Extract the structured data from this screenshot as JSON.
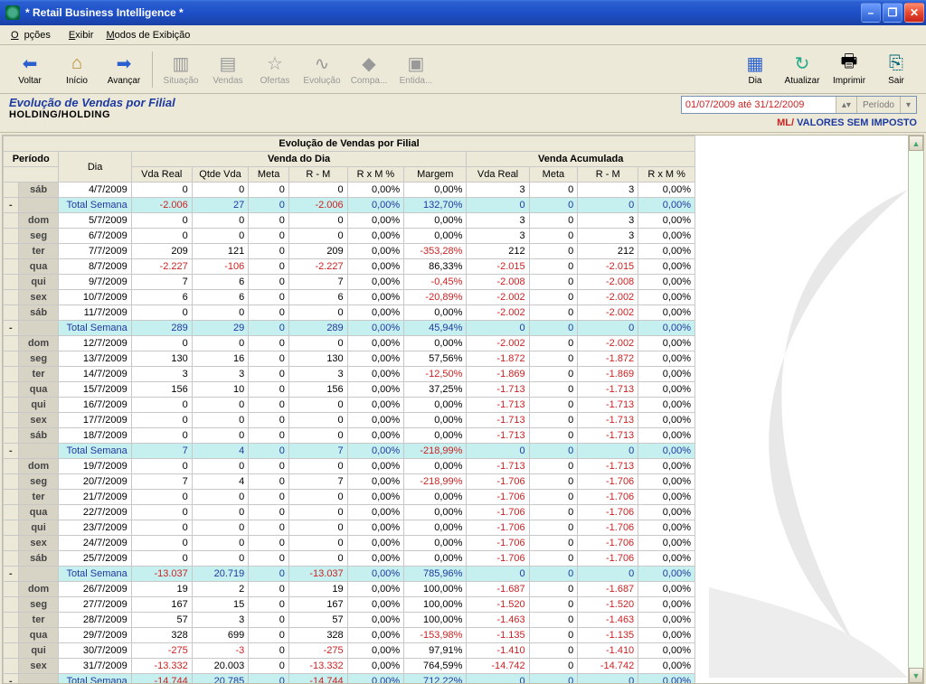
{
  "window": {
    "title": "* Retail Business Intelligence *"
  },
  "menu": {
    "opcoes": "Opções",
    "exibir": "Exibir",
    "modos": "Modos de Exibição"
  },
  "toolbar": {
    "voltar": "Voltar",
    "inicio": "Início",
    "avancar": "Avançar",
    "situacao": "Situação",
    "vendas": "Vendas",
    "ofertas": "Ofertas",
    "evolucao": "Evolução",
    "compa": "Compa...",
    "entida": "Entida...",
    "dia": "Dia",
    "atualizar": "Atualizar",
    "imprimir": "Imprimir",
    "sair": "Sair"
  },
  "header": {
    "title": "Evolução de Vendas por Filial",
    "path": "HOLDING/HOLDING",
    "date_range": "01/07/2009 até 31/12/2009",
    "period_label": "Período",
    "stamp_ml": "ML/",
    "stamp_blue": "VALORES SEM IMPOSTO"
  },
  "grid": {
    "title": "Evolução de Vendas por Filial",
    "grp_periodo": "Período",
    "grp_venda_dia": "Venda do Dia",
    "grp_venda_acum": "Venda Acumulada",
    "col_dia": "Dia",
    "col_vdareal": "Vda Real",
    "col_qtde": "Qtde Vda",
    "col_meta": "Meta",
    "col_rm": "R - M",
    "col_rxm": "R x M %",
    "col_margem": "Margem"
  },
  "rows": [
    {
      "exp": "",
      "dow": "sáb",
      "dia": "4/7/2009",
      "vr": "0",
      "qv": "0",
      "me": "0",
      "rm": "0",
      "rx": "0,00%",
      "mg": "0,00%",
      "avr": "3",
      "ame": "0",
      "arm": "3",
      "arx": "0,00%",
      "total": false,
      "neg": {}
    },
    {
      "exp": "-",
      "dow": "",
      "dia": "Total Semana",
      "vr": "-2.006",
      "qv": "27",
      "me": "0",
      "rm": "-2.006",
      "rx": "0,00%",
      "mg": "132,70%",
      "avr": "0",
      "ame": "0",
      "arm": "0",
      "arx": "0,00%",
      "total": true,
      "neg": {
        "vr": 1,
        "rm": 1
      }
    },
    {
      "exp": "",
      "dow": "dom",
      "dia": "5/7/2009",
      "vr": "0",
      "qv": "0",
      "me": "0",
      "rm": "0",
      "rx": "0,00%",
      "mg": "0,00%",
      "avr": "3",
      "ame": "0",
      "arm": "3",
      "arx": "0,00%",
      "total": false,
      "neg": {}
    },
    {
      "exp": "",
      "dow": "seg",
      "dia": "6/7/2009",
      "vr": "0",
      "qv": "0",
      "me": "0",
      "rm": "0",
      "rx": "0,00%",
      "mg": "0,00%",
      "avr": "3",
      "ame": "0",
      "arm": "3",
      "arx": "0,00%",
      "total": false,
      "neg": {}
    },
    {
      "exp": "",
      "dow": "ter",
      "dia": "7/7/2009",
      "vr": "209",
      "qv": "121",
      "me": "0",
      "rm": "209",
      "rx": "0,00%",
      "mg": "-353,28%",
      "avr": "212",
      "ame": "0",
      "arm": "212",
      "arx": "0,00%",
      "total": false,
      "neg": {
        "mg": 1
      }
    },
    {
      "exp": "",
      "dow": "qua",
      "dia": "8/7/2009",
      "vr": "-2.227",
      "qv": "-106",
      "me": "0",
      "rm": "-2.227",
      "rx": "0,00%",
      "mg": "86,33%",
      "avr": "-2.015",
      "ame": "0",
      "arm": "-2.015",
      "arx": "0,00%",
      "total": false,
      "neg": {
        "vr": 1,
        "qv": 1,
        "rm": 1,
        "avr": 1,
        "arm": 1
      }
    },
    {
      "exp": "",
      "dow": "qui",
      "dia": "9/7/2009",
      "vr": "7",
      "qv": "6",
      "me": "0",
      "rm": "7",
      "rx": "0,00%",
      "mg": "-0,45%",
      "avr": "-2.008",
      "ame": "0",
      "arm": "-2.008",
      "arx": "0,00%",
      "total": false,
      "neg": {
        "mg": 1,
        "avr": 1,
        "arm": 1
      }
    },
    {
      "exp": "",
      "dow": "sex",
      "dia": "10/7/2009",
      "vr": "6",
      "qv": "6",
      "me": "0",
      "rm": "6",
      "rx": "0,00%",
      "mg": "-20,89%",
      "avr": "-2.002",
      "ame": "0",
      "arm": "-2.002",
      "arx": "0,00%",
      "total": false,
      "neg": {
        "mg": 1,
        "avr": 1,
        "arm": 1
      }
    },
    {
      "exp": "",
      "dow": "sáb",
      "dia": "11/7/2009",
      "vr": "0",
      "qv": "0",
      "me": "0",
      "rm": "0",
      "rx": "0,00%",
      "mg": "0,00%",
      "avr": "-2.002",
      "ame": "0",
      "arm": "-2.002",
      "arx": "0,00%",
      "total": false,
      "neg": {
        "avr": 1,
        "arm": 1
      }
    },
    {
      "exp": "-",
      "dow": "",
      "dia": "Total Semana",
      "vr": "289",
      "qv": "29",
      "me": "0",
      "rm": "289",
      "rx": "0,00%",
      "mg": "45,94%",
      "avr": "0",
      "ame": "0",
      "arm": "0",
      "arx": "0,00%",
      "total": true,
      "neg": {}
    },
    {
      "exp": "",
      "dow": "dom",
      "dia": "12/7/2009",
      "vr": "0",
      "qv": "0",
      "me": "0",
      "rm": "0",
      "rx": "0,00%",
      "mg": "0,00%",
      "avr": "-2.002",
      "ame": "0",
      "arm": "-2.002",
      "arx": "0,00%",
      "total": false,
      "neg": {
        "avr": 1,
        "arm": 1
      }
    },
    {
      "exp": "",
      "dow": "seg",
      "dia": "13/7/2009",
      "vr": "130",
      "qv": "16",
      "me": "0",
      "rm": "130",
      "rx": "0,00%",
      "mg": "57,56%",
      "avr": "-1.872",
      "ame": "0",
      "arm": "-1.872",
      "arx": "0,00%",
      "total": false,
      "neg": {
        "avr": 1,
        "arm": 1
      }
    },
    {
      "exp": "",
      "dow": "ter",
      "dia": "14/7/2009",
      "vr": "3",
      "qv": "3",
      "me": "0",
      "rm": "3",
      "rx": "0,00%",
      "mg": "-12,50%",
      "avr": "-1.869",
      "ame": "0",
      "arm": "-1.869",
      "arx": "0,00%",
      "total": false,
      "neg": {
        "mg": 1,
        "avr": 1,
        "arm": 1
      }
    },
    {
      "exp": "",
      "dow": "qua",
      "dia": "15/7/2009",
      "vr": "156",
      "qv": "10",
      "me": "0",
      "rm": "156",
      "rx": "0,00%",
      "mg": "37,25%",
      "avr": "-1.713",
      "ame": "0",
      "arm": "-1.713",
      "arx": "0,00%",
      "total": false,
      "neg": {
        "avr": 1,
        "arm": 1
      }
    },
    {
      "exp": "",
      "dow": "qui",
      "dia": "16/7/2009",
      "vr": "0",
      "qv": "0",
      "me": "0",
      "rm": "0",
      "rx": "0,00%",
      "mg": "0,00%",
      "avr": "-1.713",
      "ame": "0",
      "arm": "-1.713",
      "arx": "0,00%",
      "total": false,
      "neg": {
        "avr": 1,
        "arm": 1
      }
    },
    {
      "exp": "",
      "dow": "sex",
      "dia": "17/7/2009",
      "vr": "0",
      "qv": "0",
      "me": "0",
      "rm": "0",
      "rx": "0,00%",
      "mg": "0,00%",
      "avr": "-1.713",
      "ame": "0",
      "arm": "-1.713",
      "arx": "0,00%",
      "total": false,
      "neg": {
        "avr": 1,
        "arm": 1
      }
    },
    {
      "exp": "",
      "dow": "sáb",
      "dia": "18/7/2009",
      "vr": "0",
      "qv": "0",
      "me": "0",
      "rm": "0",
      "rx": "0,00%",
      "mg": "0,00%",
      "avr": "-1.713",
      "ame": "0",
      "arm": "-1.713",
      "arx": "0,00%",
      "total": false,
      "neg": {
        "avr": 1,
        "arm": 1
      }
    },
    {
      "exp": "-",
      "dow": "",
      "dia": "Total Semana",
      "vr": "7",
      "qv": "4",
      "me": "0",
      "rm": "7",
      "rx": "0,00%",
      "mg": "-218,99%",
      "avr": "0",
      "ame": "0",
      "arm": "0",
      "arx": "0,00%",
      "total": true,
      "neg": {
        "mg": 1
      }
    },
    {
      "exp": "",
      "dow": "dom",
      "dia": "19/7/2009",
      "vr": "0",
      "qv": "0",
      "me": "0",
      "rm": "0",
      "rx": "0,00%",
      "mg": "0,00%",
      "avr": "-1.713",
      "ame": "0",
      "arm": "-1.713",
      "arx": "0,00%",
      "total": false,
      "neg": {
        "avr": 1,
        "arm": 1
      }
    },
    {
      "exp": "",
      "dow": "seg",
      "dia": "20/7/2009",
      "vr": "7",
      "qv": "4",
      "me": "0",
      "rm": "7",
      "rx": "0,00%",
      "mg": "-218,99%",
      "avr": "-1.706",
      "ame": "0",
      "arm": "-1.706",
      "arx": "0,00%",
      "total": false,
      "neg": {
        "mg": 1,
        "avr": 1,
        "arm": 1
      }
    },
    {
      "exp": "",
      "dow": "ter",
      "dia": "21/7/2009",
      "vr": "0",
      "qv": "0",
      "me": "0",
      "rm": "0",
      "rx": "0,00%",
      "mg": "0,00%",
      "avr": "-1.706",
      "ame": "0",
      "arm": "-1.706",
      "arx": "0,00%",
      "total": false,
      "neg": {
        "avr": 1,
        "arm": 1
      }
    },
    {
      "exp": "",
      "dow": "qua",
      "dia": "22/7/2009",
      "vr": "0",
      "qv": "0",
      "me": "0",
      "rm": "0",
      "rx": "0,00%",
      "mg": "0,00%",
      "avr": "-1.706",
      "ame": "0",
      "arm": "-1.706",
      "arx": "0,00%",
      "total": false,
      "neg": {
        "avr": 1,
        "arm": 1
      }
    },
    {
      "exp": "",
      "dow": "qui",
      "dia": "23/7/2009",
      "vr": "0",
      "qv": "0",
      "me": "0",
      "rm": "0",
      "rx": "0,00%",
      "mg": "0,00%",
      "avr": "-1.706",
      "ame": "0",
      "arm": "-1.706",
      "arx": "0,00%",
      "total": false,
      "neg": {
        "avr": 1,
        "arm": 1
      }
    },
    {
      "exp": "",
      "dow": "sex",
      "dia": "24/7/2009",
      "vr": "0",
      "qv": "0",
      "me": "0",
      "rm": "0",
      "rx": "0,00%",
      "mg": "0,00%",
      "avr": "-1.706",
      "ame": "0",
      "arm": "-1.706",
      "arx": "0,00%",
      "total": false,
      "neg": {
        "avr": 1,
        "arm": 1
      }
    },
    {
      "exp": "",
      "dow": "sáb",
      "dia": "25/7/2009",
      "vr": "0",
      "qv": "0",
      "me": "0",
      "rm": "0",
      "rx": "0,00%",
      "mg": "0,00%",
      "avr": "-1.706",
      "ame": "0",
      "arm": "-1.706",
      "arx": "0,00%",
      "total": false,
      "neg": {
        "avr": 1,
        "arm": 1
      }
    },
    {
      "exp": "-",
      "dow": "",
      "dia": "Total Semana",
      "vr": "-13.037",
      "qv": "20.719",
      "me": "0",
      "rm": "-13.037",
      "rx": "0,00%",
      "mg": "785,96%",
      "avr": "0",
      "ame": "0",
      "arm": "0",
      "arx": "0,00%",
      "total": true,
      "neg": {
        "vr": 1,
        "rm": 1
      }
    },
    {
      "exp": "",
      "dow": "dom",
      "dia": "26/7/2009",
      "vr": "19",
      "qv": "2",
      "me": "0",
      "rm": "19",
      "rx": "0,00%",
      "mg": "100,00%",
      "avr": "-1.687",
      "ame": "0",
      "arm": "-1.687",
      "arx": "0,00%",
      "total": false,
      "neg": {
        "avr": 1,
        "arm": 1
      }
    },
    {
      "exp": "",
      "dow": "seg",
      "dia": "27/7/2009",
      "vr": "167",
      "qv": "15",
      "me": "0",
      "rm": "167",
      "rx": "0,00%",
      "mg": "100,00%",
      "avr": "-1.520",
      "ame": "0",
      "arm": "-1.520",
      "arx": "0,00%",
      "total": false,
      "neg": {
        "avr": 1,
        "arm": 1
      }
    },
    {
      "exp": "",
      "dow": "ter",
      "dia": "28/7/2009",
      "vr": "57",
      "qv": "3",
      "me": "0",
      "rm": "57",
      "rx": "0,00%",
      "mg": "100,00%",
      "avr": "-1.463",
      "ame": "0",
      "arm": "-1.463",
      "arx": "0,00%",
      "total": false,
      "neg": {
        "avr": 1,
        "arm": 1
      }
    },
    {
      "exp": "",
      "dow": "qua",
      "dia": "29/7/2009",
      "vr": "328",
      "qv": "699",
      "me": "0",
      "rm": "328",
      "rx": "0,00%",
      "mg": "-153,98%",
      "avr": "-1.135",
      "ame": "0",
      "arm": "-1.135",
      "arx": "0,00%",
      "total": false,
      "neg": {
        "mg": 1,
        "avr": 1,
        "arm": 1
      }
    },
    {
      "exp": "",
      "dow": "qui",
      "dia": "30/7/2009",
      "vr": "-275",
      "qv": "-3",
      "me": "0",
      "rm": "-275",
      "rx": "0,00%",
      "mg": "97,91%",
      "avr": "-1.410",
      "ame": "0",
      "arm": "-1.410",
      "arx": "0,00%",
      "total": false,
      "neg": {
        "vr": 1,
        "qv": 1,
        "rm": 1,
        "avr": 1,
        "arm": 1
      }
    },
    {
      "exp": "",
      "dow": "sex",
      "dia": "31/7/2009",
      "vr": "-13.332",
      "qv": "20.003",
      "me": "0",
      "rm": "-13.332",
      "rx": "0,00%",
      "mg": "764,59%",
      "avr": "-14.742",
      "ame": "0",
      "arm": "-14.742",
      "arx": "0,00%",
      "total": false,
      "neg": {
        "vr": 1,
        "rm": 1,
        "avr": 1,
        "arm": 1
      }
    },
    {
      "exp": "-",
      "dow": "",
      "dia": "Total Semana",
      "vr": "-14.744",
      "qv": "20.785",
      "me": "0",
      "rm": "-14.744",
      "rx": "0,00%",
      "mg": "712,22%",
      "avr": "0",
      "ame": "0",
      "arm": "0",
      "arx": "0,00%",
      "total": true,
      "neg": {
        "vr": 1,
        "rm": 1
      }
    }
  ]
}
